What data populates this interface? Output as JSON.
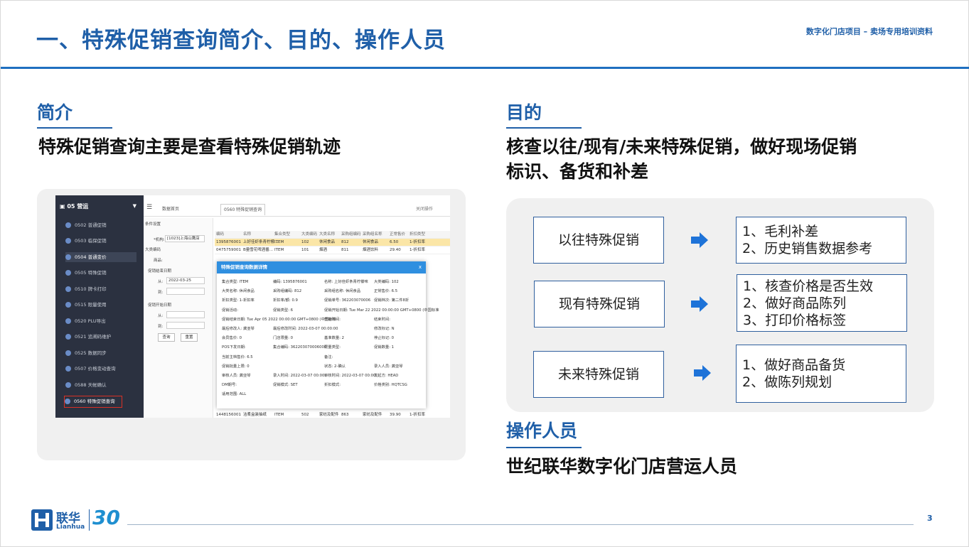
{
  "header": {
    "title": "一、特殊促销查询简介、目的、操作人员",
    "top_right": "数字化门店项目 – 卖场专用培训资料"
  },
  "intro": {
    "heading": "简介",
    "text": "特殊促销查询主要是查看特殊促销轨迹"
  },
  "purpose": {
    "heading": "目的",
    "text_line1": "核查以往/现有/未来特殊促销，做好现场促销",
    "text_line2": "标识、备货和补差",
    "rows": [
      {
        "label": "以往特殊促销",
        "items": [
          "1、毛利补差",
          "2、历史销售数据参考"
        ]
      },
      {
        "label": "现有特殊促销",
        "items": [
          "1、核查价格是否生效",
          "2、做好商品陈列",
          "3、打印价格标签"
        ]
      },
      {
        "label": "未来特殊促销",
        "items": [
          "1、做好商品备货",
          "2、做陈列规划"
        ]
      }
    ]
  },
  "operators": {
    "heading": "操作人员",
    "text": "世纪联华数字化门店营运人员"
  },
  "screenshot": {
    "sidebar_title": "05 营运",
    "menu": [
      "0502 普通促销",
      "0503 临保促销",
      "0504 普通变价",
      "0505 特殊促销",
      "0510 牌卡打印",
      "0515 限量使用",
      "0520 PLU导出",
      "0521 追溯码维护",
      "0525 数据同步",
      "0507 价格变动查询",
      "0588 天帐确认",
      "0560 特殊促销查询"
    ],
    "tabs": {
      "home": "数据首页",
      "active": "0560 特殊促销查询",
      "right": "关闭操作"
    },
    "breadcrumb": "特殊促销查询",
    "filter": {
      "label_org": "*机构:",
      "org_value": "[1023]上海山鹰店",
      "label_cat": "大类编码",
      "label_item": "商品:",
      "label_end": "促销结束日期",
      "from": "从:",
      "from_value": "2022-03-25",
      "to": "到:",
      "label_start": "促销开始日期",
      "btn_query": "查询",
      "btn_reset": "重置",
      "section_label": "条件设置"
    },
    "grid_header": [
      "编码",
      "名称",
      "集合类型",
      "大类编码",
      "大类名称",
      "采购组编码",
      "采购组名称",
      "正常售价",
      "折扣类型"
    ],
    "grid_rows": [
      [
        "1395876001",
        "上好佳虾条青柠檬...",
        "ITEM",
        "102",
        "休闲食品",
        "812",
        "休闲食品",
        "6.50",
        "1-折扣率"
      ],
      [
        "0475759001",
        "B量雪花啤酒番...",
        "ITEM",
        "101",
        "烟酒",
        "811",
        "烟酒饮料",
        "29.40",
        "1-折扣率"
      ],
      [
        "1448156001",
        "洁柔盒装抽纸",
        "ITEM",
        "502",
        "家纺及配件",
        "863",
        "家纺及配件",
        "39.90",
        "1-折扣率"
      ]
    ],
    "modal": {
      "title": "特殊促销查询数据详情",
      "close": "x",
      "rows": [
        [
          "集合类型: ITEM",
          "编码: 1395876001",
          "名称: 上好佳虾条青柠檬味",
          "大类编码: 102"
        ],
        [
          "大类名称: 休闲食品",
          "采购组编码: 812",
          "采购组名称: 休闲食品",
          "正常售价: 6.5"
        ],
        [
          "折扣类型: 1-折扣率",
          "折扣率/额: 0.9",
          "促销单号: 362203070006",
          "促销档次: 第二件8折"
        ],
        [
          "促销活动:",
          "促销类型: 6",
          "促销开始日期: Tue Mar 22 2022 00:00:00 GMT+0800 (中国标准",
          ""
        ],
        [
          "促销结束日期: Tue Apr 05 2022 00:00:00 GMT+0800 (中国标准",
          "",
          "开始时间:",
          "结束时间:"
        ],
        [
          "最后修改人: 龚亚琴",
          "最后修改时间: 2022-03-07 00:00:00",
          "",
          "修改标记: N"
        ],
        [
          "会员售价: 0",
          "门店限量: 0",
          "基准数量: 2",
          "停止标记: 0"
        ],
        [
          "POS下发日期:",
          "集合编码: 362203070006000",
          "限量类型:",
          "促销数量: 1"
        ],
        [
          "当前主档售价: 6.5",
          "",
          "备注:",
          ""
        ],
        [
          "促销批量上限: 0",
          "",
          "状态: 2-确认",
          "录入人员: 龚亚琴"
        ],
        [
          "审核人员: 龚亚琴",
          "录入时间: 2022-03-07 00:00:",
          "审核时间: 2022-03-07 00:00:",
          "发起方: HEAD"
        ],
        [
          "DM期号:",
          "促销模式: SET",
          "折扣模式:",
          "价格类别: HQTCSG"
        ],
        [
          "适用范围: ALL",
          "",
          "",
          ""
        ]
      ]
    }
  },
  "footer": {
    "logo_cn": "联华",
    "logo_en": "Lianhua",
    "logo_30": "30",
    "page": "3"
  },
  "colors": {
    "brand_blue": "#1f5fa8",
    "accent_blue": "#1f6fc0",
    "arrow_blue": "#1e73d8",
    "panel_gray": "#f0f0f0"
  }
}
